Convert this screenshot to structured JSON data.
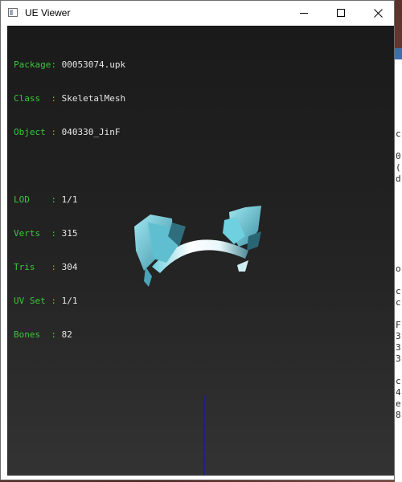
{
  "window": {
    "title": "UE Viewer",
    "icon": "app-window-icon",
    "controls": [
      "minimize-icon",
      "maximize-icon",
      "close-icon"
    ]
  },
  "info": {
    "package": {
      "label": "Package:",
      "value": "00053074.upk"
    },
    "class": {
      "label": "Class  :",
      "value": "SkeletalMesh"
    },
    "object": {
      "label": "Object :",
      "value": "040330_JinF"
    },
    "lod": {
      "label": "LOD    :",
      "value": "1/1"
    },
    "verts": {
      "label": "Verts  :",
      "value": "315"
    },
    "tris": {
      "label": "Tris   :",
      "value": "304"
    },
    "uvset": {
      "label": "UV Set :",
      "value": "1/1"
    },
    "bones": {
      "label": "Bones  :",
      "value": "82"
    }
  },
  "colors": {
    "label_green": "#37c837",
    "value_white": "#e6e6e6",
    "mesh_cyan": "#7fd6e6",
    "axis_blue": "#1a1aa0"
  },
  "console": {
    "lines": [
      "c",
      "",
      "0",
      "(",
      "d",
      "",
      "",
      "",
      "",
      "",
      "",
      "",
      "o",
      "",
      "c",
      "c",
      "",
      "F",
      "3",
      "3",
      "3",
      "",
      "c",
      "4",
      "e",
      "8"
    ]
  }
}
